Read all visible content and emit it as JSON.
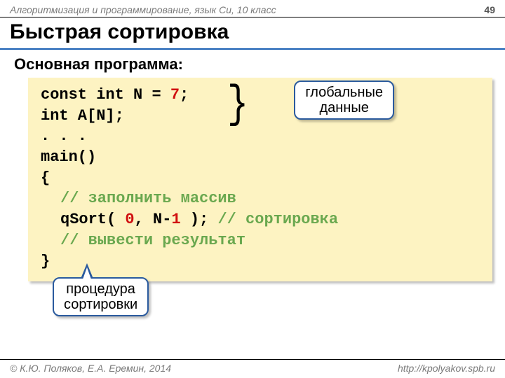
{
  "header": {
    "course": "Алгоритмизация и программирование, язык Си, 10 класс",
    "page": "49"
  },
  "title": "Быстрая сортировка",
  "subtitle": "Основная программа:",
  "code": {
    "l1a": "const int N",
    "l1b": "=",
    "l1c": "7",
    "l1d": ";",
    "l2": "int A[N];",
    "l3": ". . .",
    "l4": "main()",
    "l5": "{",
    "l6": "// заполнить массив",
    "l7a": "qSort( ",
    "l7b": "0",
    "l7c": ", N-",
    "l7d": "1",
    "l7e": " ); ",
    "l7f": "// сортировка",
    "l8": "// вывести результат",
    "l9": "}"
  },
  "callouts": {
    "global_data_l1": "глобальные",
    "global_data_l2": "данные",
    "sort_proc_l1": "процедура",
    "sort_proc_l2": "сортировки"
  },
  "footer": {
    "copyright": "© К.Ю. Поляков, Е.А. Еремин, 2014",
    "url": "http://kpolyakov.spb.ru"
  }
}
